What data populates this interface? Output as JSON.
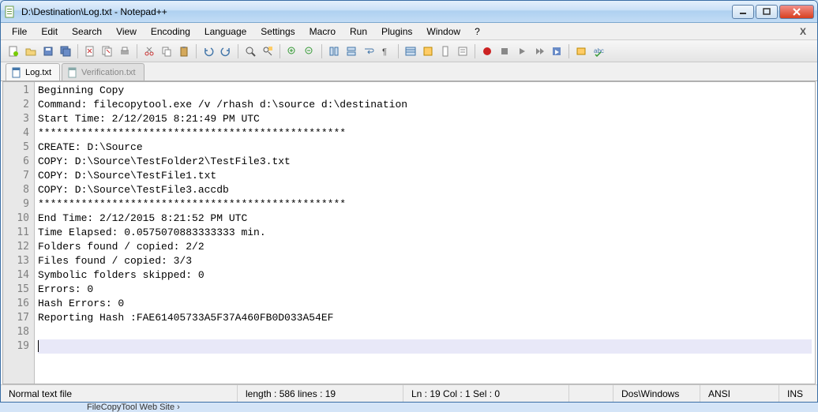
{
  "window": {
    "title": "D:\\Destination\\Log.txt - Notepad++"
  },
  "menu": {
    "file": "File",
    "edit": "Edit",
    "search": "Search",
    "view": "View",
    "encoding": "Encoding",
    "language": "Language",
    "settings": "Settings",
    "macro": "Macro",
    "run": "Run",
    "plugins": "Plugins",
    "window": "Window",
    "help": "?"
  },
  "tabs": {
    "active": "Log.txt",
    "inactive": "Verification.txt"
  },
  "lines": [
    "Beginning Copy",
    "Command: filecopytool.exe /v /rhash d:\\source d:\\destination",
    "Start Time: 2/12/2015 8:21:49 PM UTC",
    "**************************************************",
    "CREATE: D:\\Source",
    "COPY: D:\\Source\\TestFolder2\\TestFile3.txt",
    "COPY: D:\\Source\\TestFile1.txt",
    "COPY: D:\\Source\\TestFile3.accdb",
    "**************************************************",
    "End Time: 2/12/2015 8:21:52 PM UTC",
    "Time Elapsed: 0.0575070883333333 min.",
    "Folders found / copied: 2/2",
    "Files found / copied: 3/3",
    "Symbolic folders skipped: 0",
    "Errors: 0",
    "Hash Errors: 0",
    "Reporting Hash :FAE61405733A5F37A460FB0D033A54EF",
    "",
    ""
  ],
  "lineNumbers": [
    "1",
    "2",
    "3",
    "4",
    "5",
    "6",
    "7",
    "8",
    "9",
    "10",
    "11",
    "12",
    "13",
    "14",
    "15",
    "16",
    "17",
    "18",
    "19"
  ],
  "status": {
    "filetype": "Normal text file",
    "length": "length : 586    lines : 19",
    "pos": "Ln : 19    Col : 1    Sel : 0",
    "eol": "Dos\\Windows",
    "enc": "ANSI",
    "ins": "INS"
  },
  "taskbar": "FileCopyTool Web Site ›"
}
